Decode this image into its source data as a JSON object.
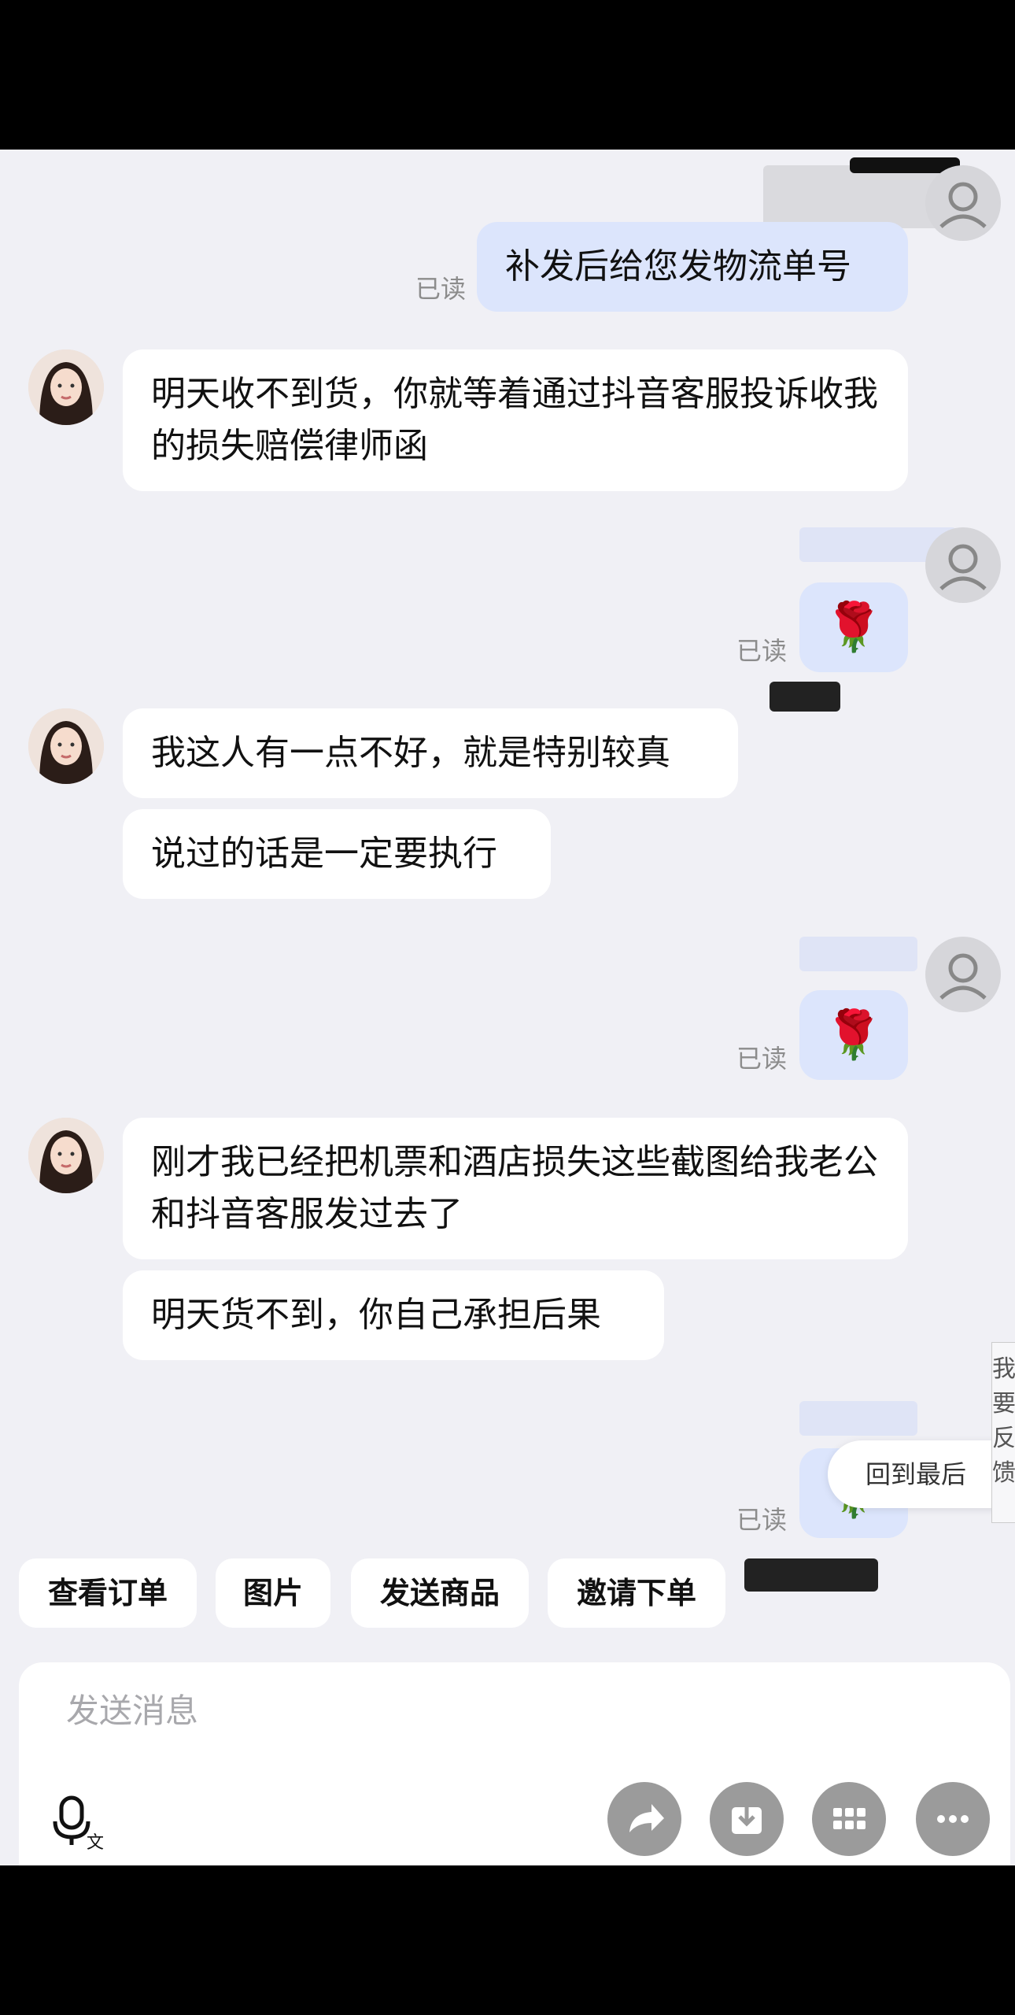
{
  "messages": [
    {
      "side": "right",
      "type": "text",
      "text": "补发后给您发物流单号",
      "read": "已读"
    },
    {
      "side": "left",
      "type": "text",
      "text": "明天收不到货，你就等着通过抖音客服投诉收我的损失赔偿律师函"
    },
    {
      "side": "right",
      "type": "emoji",
      "emoji": "🌹",
      "read": "已读"
    },
    {
      "side": "left",
      "type": "text",
      "text": "我这人有一点不好，就是特别较真"
    },
    {
      "side": "left",
      "type": "text",
      "text": "说过的话是一定要执行"
    },
    {
      "side": "right",
      "type": "emoji",
      "emoji": "🌹",
      "read": "已读"
    },
    {
      "side": "left",
      "type": "text",
      "text": "刚才我已经把机票和酒店损失这些截图给我老公和抖音客服发过去了"
    },
    {
      "side": "left",
      "type": "text",
      "text": "明天货不到，你自己承担后果"
    },
    {
      "side": "right",
      "type": "emoji",
      "emoji": "🌹",
      "read": "已读"
    }
  ],
  "floating": {
    "jump_latest": "回到最后",
    "feedback": "我要反馈"
  },
  "quick_actions": [
    "查看订单",
    "图片",
    "发送商品",
    "邀请下单"
  ],
  "composer": {
    "placeholder": "发送消息",
    "icons": [
      "voice-to-text-icon",
      "share-icon",
      "download-icon",
      "grid-icon",
      "more-icon"
    ]
  },
  "colors": {
    "chat_bg": "#f0f0f5",
    "incoming_bubble": "#ffffff",
    "outgoing_bubble": "#dce5fc",
    "icon_button": "#9b9b9b"
  }
}
